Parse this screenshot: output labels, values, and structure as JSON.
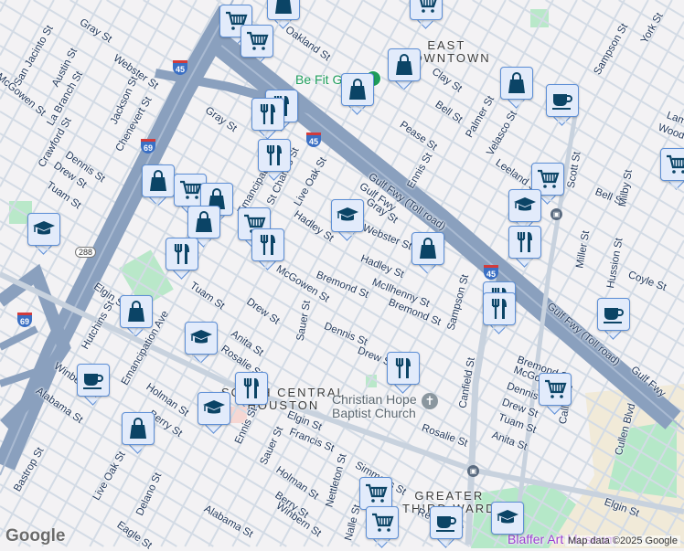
{
  "map": {
    "areas": {
      "east_downtown": [
        "EAST",
        "DOWNTOWN"
      ],
      "south_central": [
        "SOUTH CENTRAL",
        "HOUSTON"
      ],
      "greater_third_ward": [
        "GREATER",
        "THIRD WARD"
      ]
    },
    "pois": {
      "be_fit": "Be Fit Gym",
      "church": [
        "Christian Hope",
        "Baptist Church"
      ],
      "museum": "Blaffer Art Museum"
    },
    "streets": [
      "Gray St",
      "San Jacinto St",
      "Austin St",
      "Webster St",
      "McGowen St",
      "La Branch St",
      "Jackson St",
      "Chenevert St",
      "Crawford St",
      "Dennis St",
      "Drew St",
      "Tuam St",
      "Gray St",
      "Emancipation Ave",
      "St Charles St",
      "Live Oak St",
      "Hadley St",
      "Gulf Fwy (Toll road)",
      "Gulf Fwy",
      "Gray St",
      "Webster St",
      "Hadley St",
      "Clay St",
      "Bell St",
      "Pease St",
      "Ennis St",
      "Palmer St",
      "Velasco St",
      "Leeland St",
      "Sampson St",
      "York St",
      "Scott St",
      "Bell St",
      "Milby St",
      "Miller St",
      "Hussion St",
      "Lamar St",
      "Woodleigh St",
      "Coyle St",
      "McIlhenny St",
      "Bremond St",
      "Bremond St",
      "Sampson St",
      "Dennis St",
      "Drew St",
      "Canfield St",
      "Rosalie St",
      "Bremond St",
      "McGowen St",
      "Dennis St",
      "Drew St",
      "Tuam St",
      "Anita St",
      "Callie St",
      "Cullen Blvd",
      "Gulf Fwy (Toll road)",
      "Gulf Fwy",
      "Elgin St",
      "Elgin St",
      "McGowen St",
      "Tuam St",
      "Drew St",
      "Sauer St",
      "Elgin St",
      "Hutchins St",
      "Emancipation Ave",
      "Anita St",
      "Rosalie St",
      "Winbern St",
      "Alabama St",
      "Holman St",
      "Berry St",
      "Ennis St",
      "Sauer St",
      "Francis St",
      "Bastrop St",
      "Live Oak St",
      "Delano St",
      "Alabama St",
      "Holman St",
      "Berry St",
      "Winbern St",
      "Nettleton St",
      "Simmons St",
      "Nalle St",
      "Reeves St",
      "Eagle St",
      "Oakland St"
    ],
    "shields": {
      "i45": "45",
      "i69": "69",
      "sr288": "288"
    },
    "markers": [
      "cart",
      "cart",
      "bag",
      "cart",
      "bag",
      "bag",
      "bag",
      "coffee",
      "cart",
      "cart",
      "grad",
      "restaurant",
      "grad",
      "bag",
      "grad",
      "restaurant",
      "restaurant",
      "restaurant",
      "bag",
      "cart",
      "bag",
      "bag",
      "cart",
      "restaurant",
      "restaurant",
      "restaurant",
      "restaurant",
      "coffee",
      "grad",
      "bag",
      "coffee",
      "bag",
      "grad",
      "restaurant",
      "restaurant",
      "cart",
      "cart",
      "grad",
      "cart",
      "coffee"
    ],
    "footer": {
      "attribution": "Map data ©2025 Google",
      "logo": "Google"
    },
    "colors": {
      "marker_icon": "#0b4466",
      "marker_bg": "#e2ebfb",
      "marker_border": "#5d8fd6",
      "freeway": "#8aa0be",
      "park": "#b5e8c8",
      "green_pin": "#1e9d5b"
    }
  }
}
